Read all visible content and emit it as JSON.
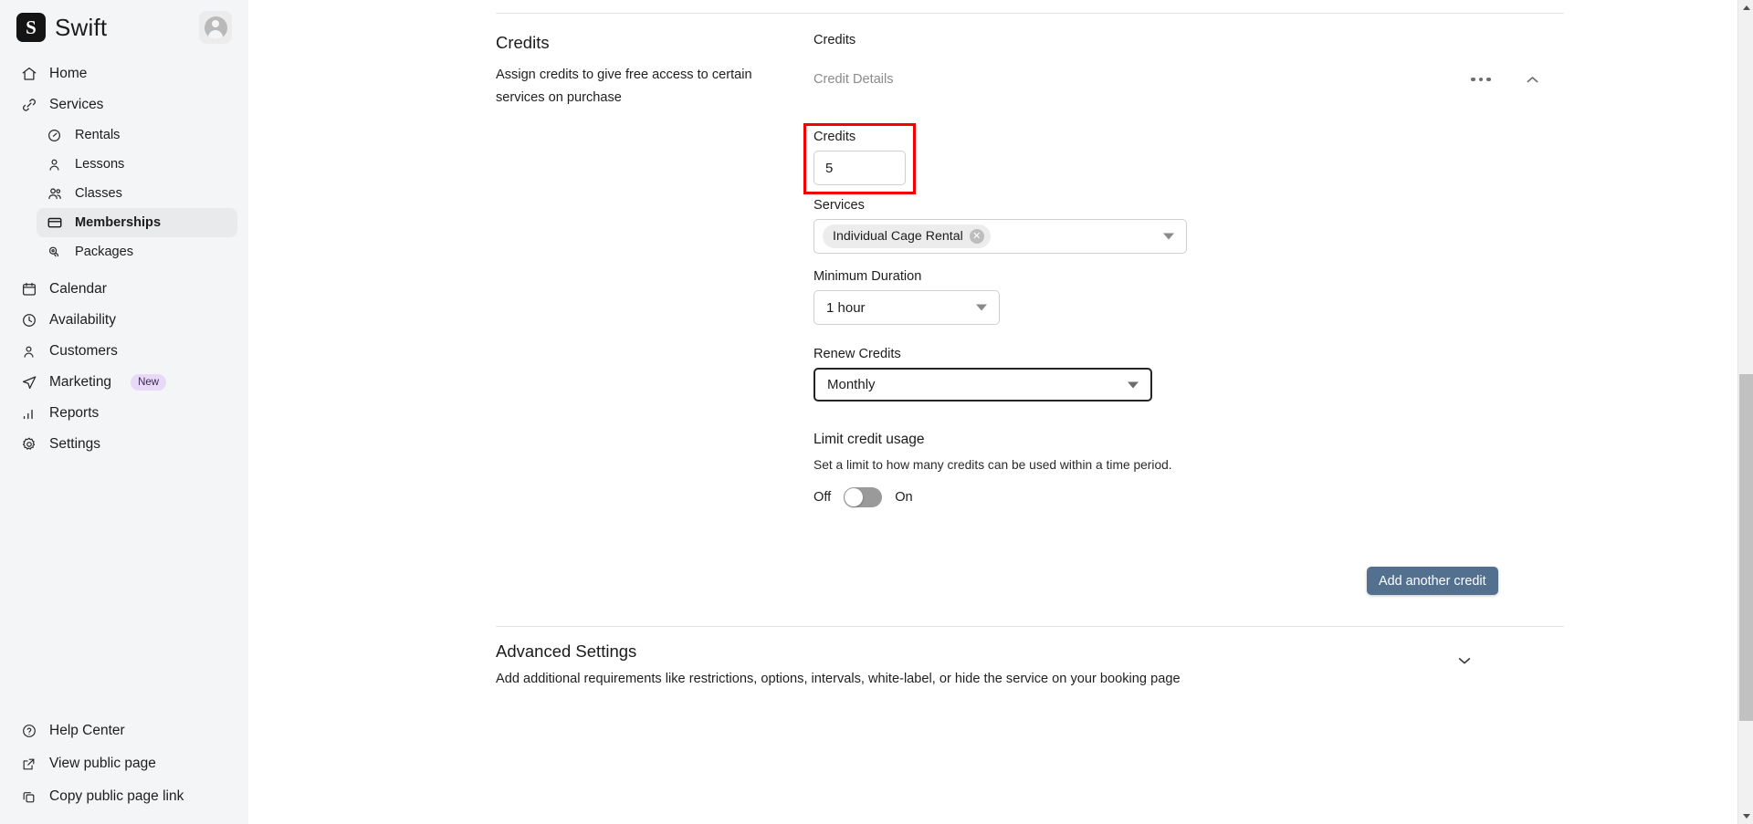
{
  "brand": {
    "mark": "S",
    "name": "Swift",
    "avatar_icon": "user-avatar-icon"
  },
  "sidebar": {
    "items": [
      {
        "label": "Home",
        "icon": "home-icon"
      },
      {
        "label": "Services",
        "icon": "link-icon"
      }
    ],
    "services_children": [
      {
        "label": "Rentals",
        "icon": "gauge-icon"
      },
      {
        "label": "Lessons",
        "icon": "person-icon"
      },
      {
        "label": "Classes",
        "icon": "people-icon"
      },
      {
        "label": "Memberships",
        "icon": "card-icon",
        "active": true
      },
      {
        "label": "Packages",
        "icon": "tags-icon"
      }
    ],
    "items_lower": [
      {
        "label": "Calendar",
        "icon": "calendar-icon"
      },
      {
        "label": "Availability",
        "icon": "clock-icon"
      },
      {
        "label": "Customers",
        "icon": "person-icon"
      },
      {
        "label": "Marketing",
        "icon": "send-icon",
        "badge": "New"
      },
      {
        "label": "Reports",
        "icon": "bar-chart-icon"
      },
      {
        "label": "Settings",
        "icon": "gear-icon"
      }
    ],
    "footer": [
      {
        "label": "Help Center",
        "icon": "question-circle-icon"
      },
      {
        "label": "View public page",
        "icon": "external-link-icon"
      },
      {
        "label": "Copy public page link",
        "icon": "copy-icon"
      }
    ]
  },
  "credits_section": {
    "title": "Credits",
    "description": "Assign credits to give free access to certain services on purchase",
    "panel_label": "Credits",
    "panel_subtitle": "Credit Details",
    "more_icon": "ellipsis-icon",
    "collapse_icon": "chevron-up-icon",
    "credits_field": {
      "label": "Credits",
      "value": "5",
      "highlight_color": "#f40000"
    },
    "services_field": {
      "label": "Services",
      "chips": [
        "Individual Cage Rental"
      ],
      "chip_remove_icon": "close-circle-icon",
      "caret_icon": "chevron-down-icon"
    },
    "minimum_duration_field": {
      "label": "Minimum Duration",
      "value": "1 hour",
      "caret_icon": "chevron-down-icon"
    },
    "renew_credits_field": {
      "label": "Renew Credits",
      "value": "Monthly",
      "caret_icon": "chevron-down-icon",
      "focused": true
    },
    "limit_credit_usage": {
      "title": "Limit credit usage",
      "description": "Set a limit to how many credits can be used within a time period.",
      "off_label": "Off",
      "on_label": "On",
      "state": "off"
    },
    "add_button": {
      "label": "Add another credit",
      "color": "#54708f"
    }
  },
  "advanced_settings": {
    "title": "Advanced Settings",
    "description": "Add additional requirements like restrictions, options, intervals, white-label, or hide the service on your booking page",
    "chevron_icon": "chevron-down-icon"
  }
}
